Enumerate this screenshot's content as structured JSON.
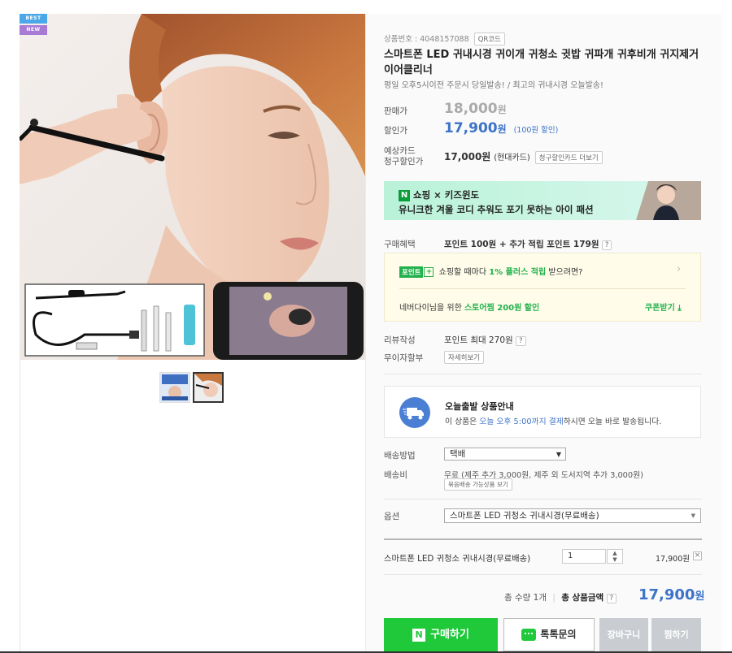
{
  "badges": {
    "best": "BEST",
    "new": "NEW"
  },
  "product": {
    "number_label": "상품번호 : 4048157088",
    "qr_label": "QR코드",
    "title": "스마트폰 LED 귀내시경 귀이개 귀청소 귓밥 귀파개 귀후비개 귀지제거 이어클리너",
    "subtitle": "평일 오후5시이전 주문시 당일발송! / 최고의 귀내시경 오늘발송!"
  },
  "price": {
    "sale_label": "판매가",
    "original": "18,000",
    "won": "원",
    "discount_label": "할인가",
    "discounted": "17,900",
    "discount_note": "(100원 할인)",
    "card_label_1": "예상카드",
    "card_label_2": "청구할인가",
    "card_price": "17,000원",
    "card_name": "(현대카드)",
    "card_more": "청구할인카드 더보기"
  },
  "banner": {
    "n_mark": "N",
    "line1": "쇼핑 × 키즈윈도",
    "line2": "유니크한 겨울 코디 추워도 포기 못하는 아이 패션"
  },
  "benefit": {
    "label": "구매혜택",
    "text": "포인트 100원 + 추가 적립 포인트 179원",
    "help": "?",
    "point_badge": "포인트",
    "plus": "+",
    "plus_pre": "쇼핑할 때마다 ",
    "plus_highlight": "1% 플러스 적립",
    "plus_post": " 받으려면?",
    "store_pre": "네버다이님을 위한 ",
    "store_highlight": "스토어찜 200원 할인",
    "coupon": "쿠폰받기 ⤓"
  },
  "review": {
    "label": "리뷰작성",
    "text": "포인트 최대 270원",
    "help": "?"
  },
  "installment": {
    "label": "무이자할부",
    "btn": "자세히보기"
  },
  "today_ship": {
    "title": "오늘출발 상품안내",
    "pre": "이 상품은 ",
    "highlight": "오늘 오후 5:00까지 결제",
    "post": "하시면 오늘 바로 발송됩니다."
  },
  "shipping": {
    "method_label": "배송방법",
    "method_value": "택배",
    "fee_label": "배송비",
    "fee_value": "무료 (제주 추가 3,000원, 제주 외 도서지역 추가 3,000원)",
    "bundle_btn": "묶음배송 가능상품 보기"
  },
  "option": {
    "label": "옵션",
    "value": "스마트폰 LED 귀청소 귀내시경(무료배송)"
  },
  "selected": {
    "name": "스마트폰 LED 귀청소 귀내시경(무료배송)",
    "qty": "1",
    "price": "17,900원",
    "remove": "×"
  },
  "total": {
    "qty_text": "총 수량 1개",
    "sep": "|",
    "label": "총 상품금액",
    "help": "?",
    "price": "17,900",
    "won": "원"
  },
  "buttons": {
    "buy_n": "N",
    "buy": "구매하기",
    "talk": "톡톡문의",
    "cart": "장바구니",
    "wish": "찜하기"
  },
  "colors": {
    "accent_blue": "#3d73c8",
    "buy_green": "#1fc939",
    "point_green": "#22b14c"
  }
}
